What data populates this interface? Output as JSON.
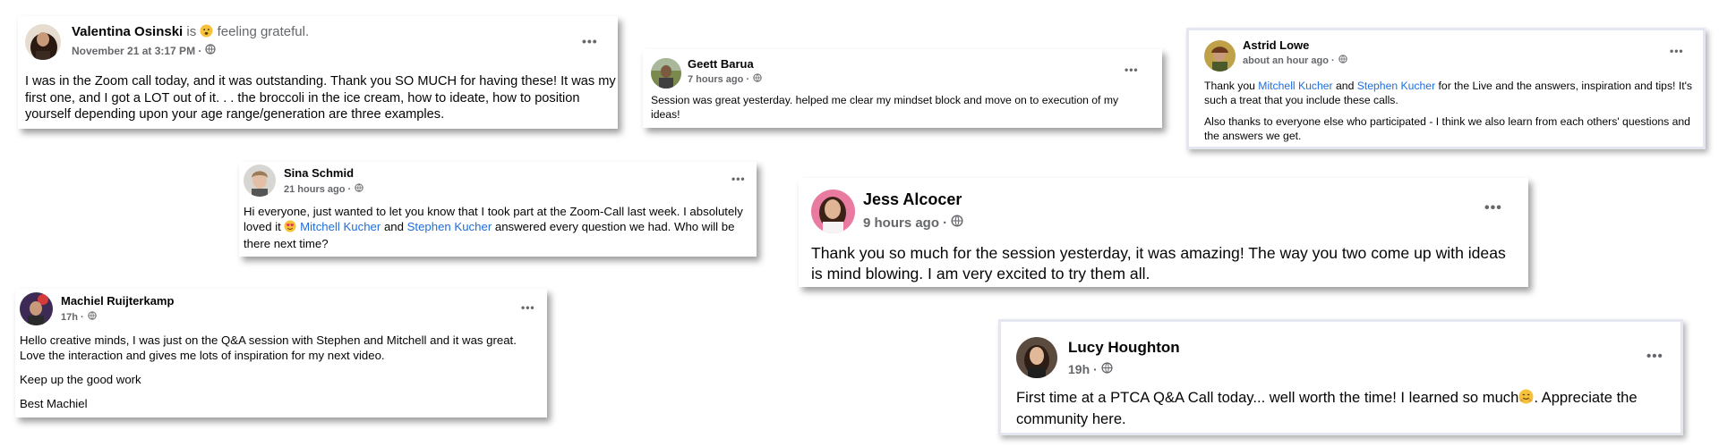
{
  "posts": {
    "valentina": {
      "name": "Valentina Osinski",
      "feeling_prefix": "is",
      "feeling": "feeling grateful.",
      "time": "November 21 at 3:17 PM ·",
      "body": "I was in the Zoom call today, and it was outstanding. Thank you SO MUCH for having these! It was my first one, and I got a LOT out of it. . . the broccoli in the ice cream, how to ideate, how to position yourself depending upon your age range/generation are three examples."
    },
    "geett": {
      "name": "Geett Barua",
      "time": "7 hours ago ·",
      "body": "Session was great yesterday. helped me clear my mindset block and move on to execution of my ideas!"
    },
    "astrid": {
      "name": "Astrid Lowe",
      "time": "about an hour ago ·",
      "p1_a": "Thank you ",
      "p1_link1": "Mitchell Kucher",
      "p1_b": " and ",
      "p1_link2": "Stephen Kucher",
      "p1_c": " for the Live and the answers, inspiration and tips! It's such a treat that you include these calls.",
      "p2": "Also thanks to everyone else who participated - I think we also learn from each others' questions and the answers we get."
    },
    "sina": {
      "name": "Sina Schmid",
      "time": "21 hours ago ·",
      "a": "Hi everyone, just wanted to let you know that I took part at the Zoom-Call last week. I absolutely loved it ",
      "link1": "Mitchell Kucher",
      "b": " and ",
      "link2": "Stephen Kucher",
      "c": " answered every question we had. Who will be there next time?"
    },
    "jess": {
      "name": "Jess Alcocer",
      "time": "9 hours ago ·",
      "body": "Thank you so much for the session yesterday, it was amazing! The way you two come up with ideas is mind blowing. I am very excited to try them all."
    },
    "machiel": {
      "name": "Machiel Ruijterkamp",
      "time": "17h ·",
      "p1": "Hello creative minds, I was just on the Q&A session with Stephen and Mitchell and it was great. Love the interaction and gives me lots of inspiration for my next video.",
      "p2": "Keep up the good work",
      "p3": "Best Machiel"
    },
    "lucy": {
      "name": "Lucy Houghton",
      "time": "19h ·",
      "a": "First time at a PTCA Q&A Call today... well worth the time! I learned so much",
      "b": ".  Appreciate the community here."
    }
  },
  "more_label": "•••",
  "colors": {
    "link": "#216fdb",
    "meta": "#65676b",
    "text": "#050505"
  }
}
